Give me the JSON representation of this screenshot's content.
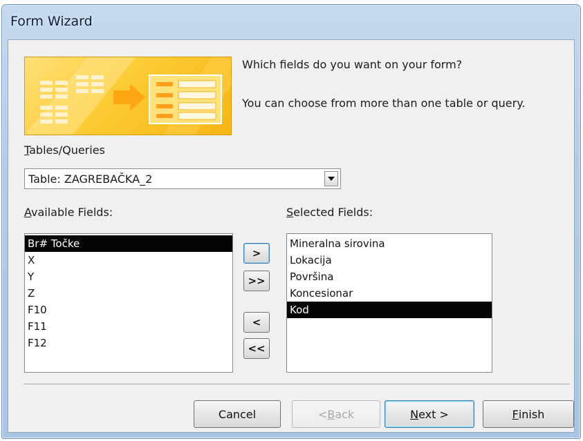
{
  "window": {
    "title": "Form Wizard"
  },
  "prompt": {
    "question": "Which fields do you want on your form?",
    "subtitle": "You can choose from more than one table or query."
  },
  "tables": {
    "label_mnemonic": "T",
    "label_rest": "ables/Queries",
    "selected": "Table: ZAGREBAČKA_2"
  },
  "available": {
    "label_mnemonic": "A",
    "label_rest": "vailable Fields:",
    "items": [
      "Br# Točke",
      "X",
      "Y",
      "Z",
      "F10",
      "F11",
      "F12"
    ],
    "selected_index": 0
  },
  "selected_fields": {
    "label_mnemonic": "S",
    "label_rest": "elected Fields:",
    "items": [
      "Mineralna sirovina",
      "Lokacija",
      "Površina",
      "Koncesionar",
      "Kod"
    ],
    "selected_index": 4
  },
  "move_buttons": {
    "add_one": ">",
    "add_all": ">>",
    "remove_one": "<",
    "remove_all": "<<"
  },
  "footer": {
    "cancel": "Cancel",
    "back_prefix": "< ",
    "back_mnemonic": "B",
    "back_rest": "ack",
    "next_mnemonic": "N",
    "next_rest": "ext >",
    "finish_mnemonic": "F",
    "finish_rest": "inish"
  },
  "colors": {
    "banner": "#fccb34",
    "selection": "#050505",
    "title_bar": "#b3cbe7"
  }
}
